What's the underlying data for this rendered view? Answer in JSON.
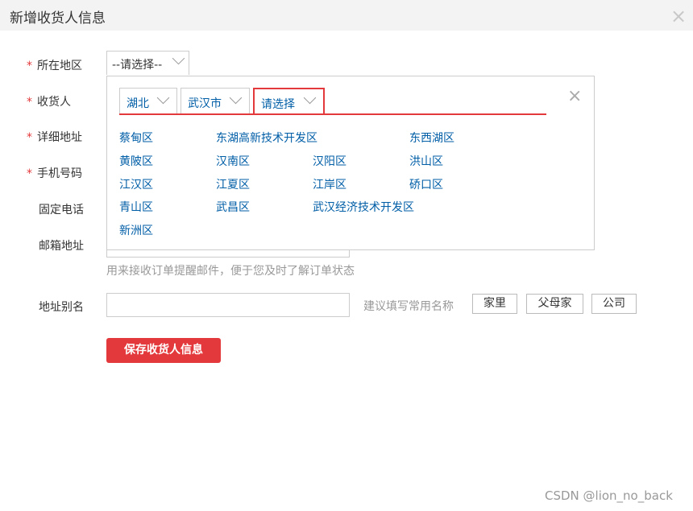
{
  "dialog": {
    "title": "新增收货人信息",
    "close_icon": "close-icon"
  },
  "form": {
    "region_label": "所在地区",
    "receiver_label": "收货人",
    "detail_address_label": "详细地址",
    "phone_label": "手机号码",
    "landline_label": "固定电话",
    "email_label": "邮箱地址",
    "email_hint": "用来接收订单提醒邮件，便于您及时了解订单状态",
    "alias_label": "地址别名",
    "alias_hint": "建议填写常用名称",
    "alias_tags": [
      "家里",
      "父母家",
      "公司"
    ],
    "save_button": "保存收货人信息",
    "required_mark": "*"
  },
  "region_select": {
    "placeholder": "--请选择--",
    "tabs": [
      {
        "label": "湖北"
      },
      {
        "label": "武汉市"
      },
      {
        "label": "请选择"
      }
    ],
    "districts": [
      "蔡甸区",
      "东湖高新技术开发区",
      "东西湖区",
      "黄陂区",
      "汉南区",
      "汉阳区",
      "洪山区",
      "江汉区",
      "江夏区",
      "江岸区",
      "硚口区",
      "青山区",
      "武昌区",
      "武汉经济技术开发区",
      "新洲区"
    ]
  },
  "watermark": "CSDN @lion_no_back",
  "colors": {
    "accent": "#e4393c",
    "link": "#005ea7"
  }
}
